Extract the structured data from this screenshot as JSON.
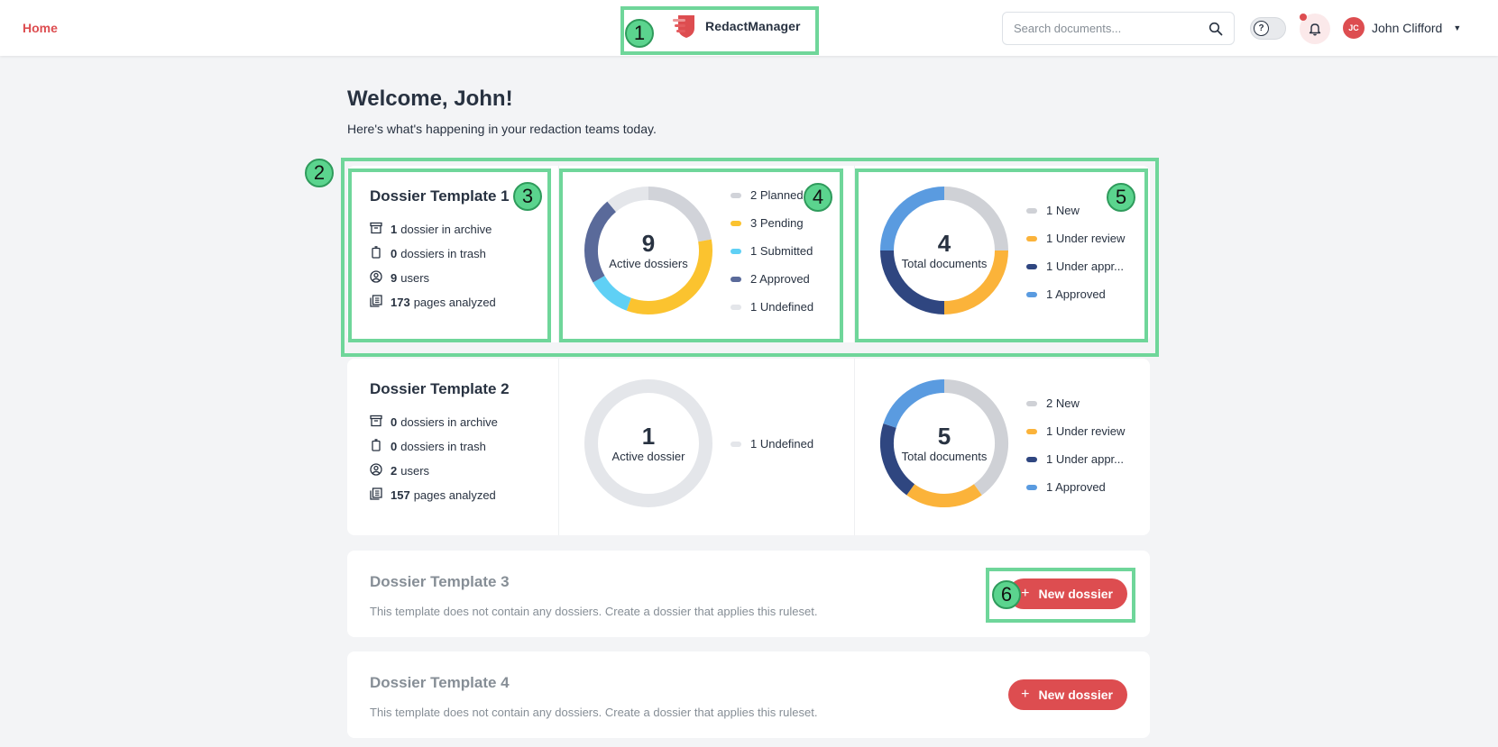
{
  "header": {
    "home_label": "Home",
    "app_name": "RedactManager",
    "search_placeholder": "Search documents...",
    "help_glyph": "?",
    "user_initials": "JC",
    "user_name": "John Clifford",
    "accent_color": "#dd4d50"
  },
  "welcome": {
    "title": "Welcome, John!",
    "subtitle": "Here's what's happening in your redaction teams today."
  },
  "templates": [
    {
      "name": "Dossier Template 1",
      "stats": [
        {
          "icon": "archive-icon",
          "count": "1",
          "label": "dossier in archive"
        },
        {
          "icon": "trash-icon",
          "count": "0",
          "label": "dossiers in trash"
        },
        {
          "icon": "user-icon",
          "count": "9",
          "label": "users"
        },
        {
          "icon": "pages-icon",
          "count": "173",
          "label": "pages analyzed"
        }
      ],
      "dossiers": {
        "total": "9",
        "label": "Active dossiers",
        "legend": [
          {
            "label": "2 Planned",
            "value": 2,
            "color": "#d1d3d9"
          },
          {
            "label": "3 Pending",
            "value": 3,
            "color": "#fbc32f"
          },
          {
            "label": "1 Submitted",
            "value": 1,
            "color": "#5fd0f5"
          },
          {
            "label": "2 Approved",
            "value": 2,
            "color": "#5a6a9a"
          },
          {
            "label": "1 Undefined",
            "value": 1,
            "color": "#e4e6ea"
          }
        ]
      },
      "documents": {
        "total": "4",
        "label": "Total documents",
        "legend": [
          {
            "label": "1 New",
            "value": 1,
            "color": "#cfd1d6"
          },
          {
            "label": "1 Under review",
            "value": 1,
            "color": "#fbb33a"
          },
          {
            "label": "1 Under appr...",
            "value": 1,
            "color": "#2f4680"
          },
          {
            "label": "1 Approved",
            "value": 1,
            "color": "#5a9be0"
          }
        ]
      }
    },
    {
      "name": "Dossier Template 2",
      "stats": [
        {
          "icon": "archive-icon",
          "count": "0",
          "label": "dossiers in archive"
        },
        {
          "icon": "trash-icon",
          "count": "0",
          "label": "dossiers in trash"
        },
        {
          "icon": "user-icon",
          "count": "2",
          "label": "users"
        },
        {
          "icon": "pages-icon",
          "count": "157",
          "label": "pages analyzed"
        }
      ],
      "dossiers": {
        "total": "1",
        "label": "Active dossier",
        "legend": [
          {
            "label": "1 Undefined",
            "value": 1,
            "color": "#e4e6ea"
          }
        ]
      },
      "documents": {
        "total": "5",
        "label": "Total documents",
        "legend": [
          {
            "label": "2 New",
            "value": 2,
            "color": "#cfd1d6"
          },
          {
            "label": "1 Under review",
            "value": 1,
            "color": "#fbb33a"
          },
          {
            "label": "1 Under appr...",
            "value": 1,
            "color": "#2f4680"
          },
          {
            "label": "1 Approved",
            "value": 1,
            "color": "#5a9be0"
          }
        ]
      }
    }
  ],
  "empty_templates": [
    {
      "name": "Dossier Template 3",
      "description": "This template does not contain any dossiers. Create a dossier that applies this ruleset.",
      "button_label": "New dossier"
    },
    {
      "name": "Dossier Template 4",
      "description": "This template does not contain any dossiers. Create a dossier that applies this ruleset.",
      "button_label": "New dossier"
    }
  ],
  "annotations": [
    "1",
    "2",
    "3",
    "4",
    "5",
    "6"
  ]
}
